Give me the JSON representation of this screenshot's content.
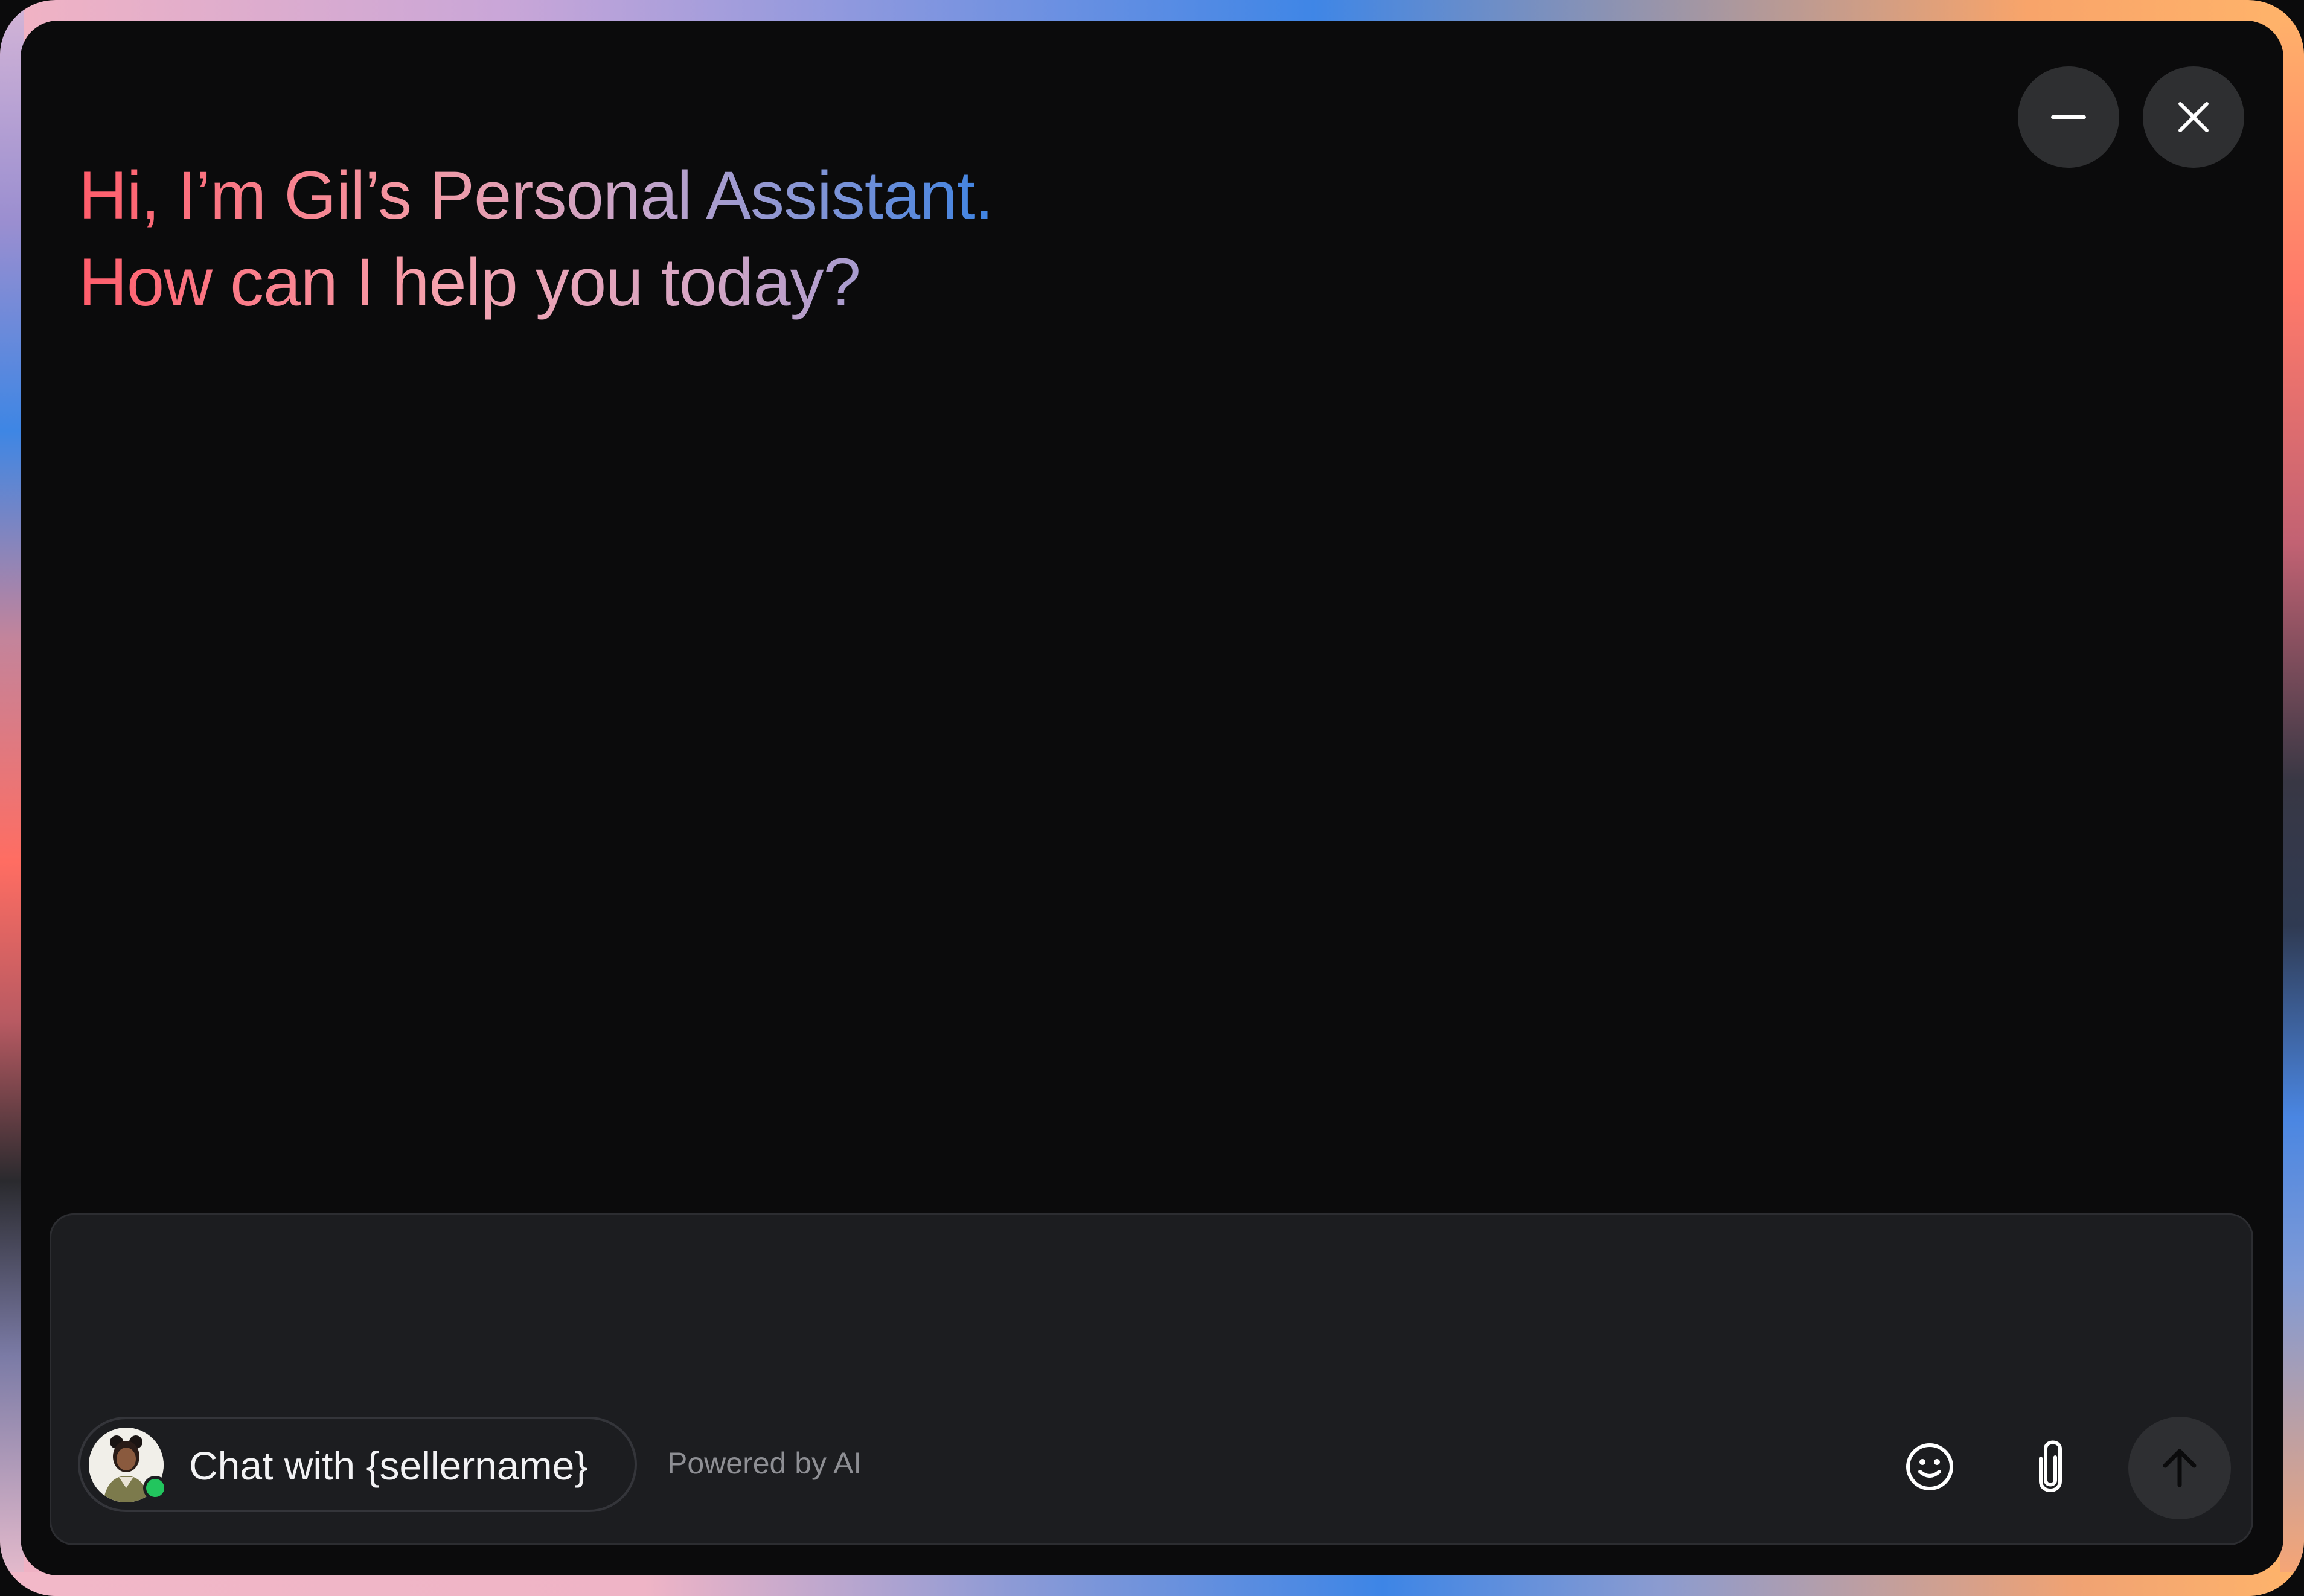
{
  "window": {
    "minimize_label": "Minimize",
    "close_label": "Close"
  },
  "greeting": {
    "line1": "Hi, I’m Gil’s Personal Assistant.",
    "line2": "How can I help you today?"
  },
  "composer": {
    "value": "",
    "placeholder": "",
    "seller_chat_label": "Chat with {sellername}",
    "powered_by": "Powered by AI",
    "seller_status": "online"
  },
  "icons": {
    "minimize": "minus-icon",
    "close": "close-icon",
    "emoji": "smiley-icon",
    "attach": "paperclip-icon",
    "send": "arrow-up-icon"
  },
  "colors": {
    "background": "#0b0b0c",
    "composer_bg": "#1c1d20",
    "button_bg": "#2e2f31",
    "status_online": "#22c55e",
    "greeting_gradient_start": "#ff5d6b",
    "greeting_gradient_end": "#3e83e2"
  }
}
